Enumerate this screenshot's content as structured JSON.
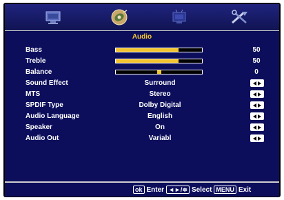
{
  "menu": {
    "tabs": [
      {
        "name": "picture-tab",
        "icon": "monitor-icon"
      },
      {
        "name": "audio-tab",
        "icon": "speaker-disc-icon"
      },
      {
        "name": "channel-tab",
        "icon": "tv-icon"
      },
      {
        "name": "setup-tab",
        "icon": "tools-icon"
      }
    ],
    "title": "Audio",
    "items": [
      {
        "label": "Bass",
        "type": "slider",
        "value": "50",
        "level": 0.73
      },
      {
        "label": "Treble",
        "type": "slider",
        "value": "50",
        "level": 0.73
      },
      {
        "label": "Balance",
        "type": "balance",
        "value": "0",
        "level": 0.5
      },
      {
        "label": "Sound Effect",
        "type": "option",
        "value": "Surround"
      },
      {
        "label": "MTS",
        "type": "option",
        "value": "Stereo"
      },
      {
        "label": "SPDIF Type",
        "type": "option",
        "value": "Dolby Digital"
      },
      {
        "label": "Audio Language",
        "type": "option",
        "value": "English"
      },
      {
        "label": "Speaker",
        "type": "option",
        "value": "On"
      },
      {
        "label": "Audio Out",
        "type": "option",
        "value": "Variabl"
      }
    ]
  },
  "footer": {
    "ok_key": "ok",
    "enter_label": "Enter",
    "nav_key": "◄►/≑",
    "select_label": "Select",
    "menu_key": "MENU",
    "exit_label": "Exit"
  },
  "colors": {
    "accent": "#f4c430",
    "panel": "#0c0e5c",
    "background": "#000000"
  }
}
